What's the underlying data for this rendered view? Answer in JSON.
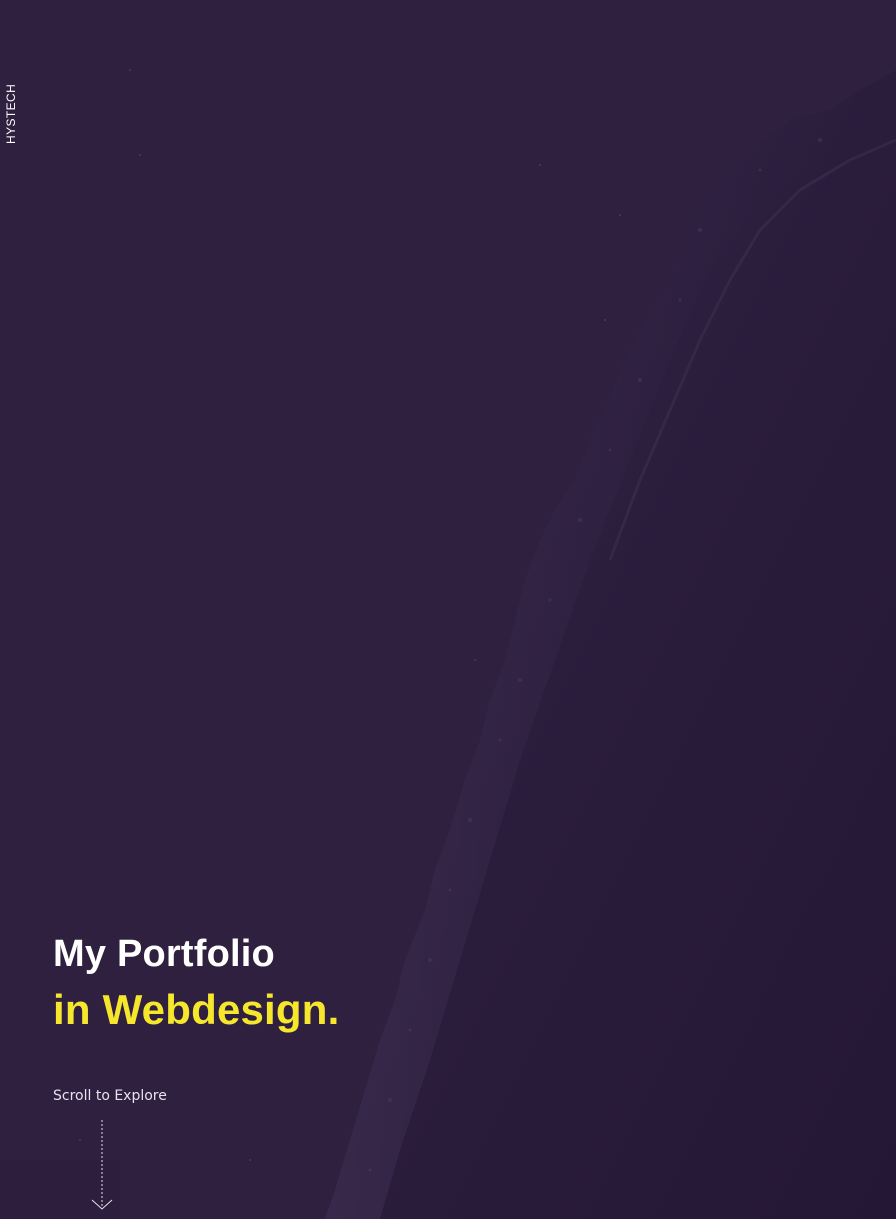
{
  "brand": {
    "name": "HYSTECH"
  },
  "hero": {
    "title_line1": "My Portfolio",
    "title_line2": "in Webdesign.",
    "scroll_label": "Scroll to Explore"
  },
  "colors": {
    "background": "#2f2040",
    "accent": "#f6e72d",
    "text": "#ffffff"
  },
  "icons": {
    "scroll": "arrow-down-icon"
  }
}
